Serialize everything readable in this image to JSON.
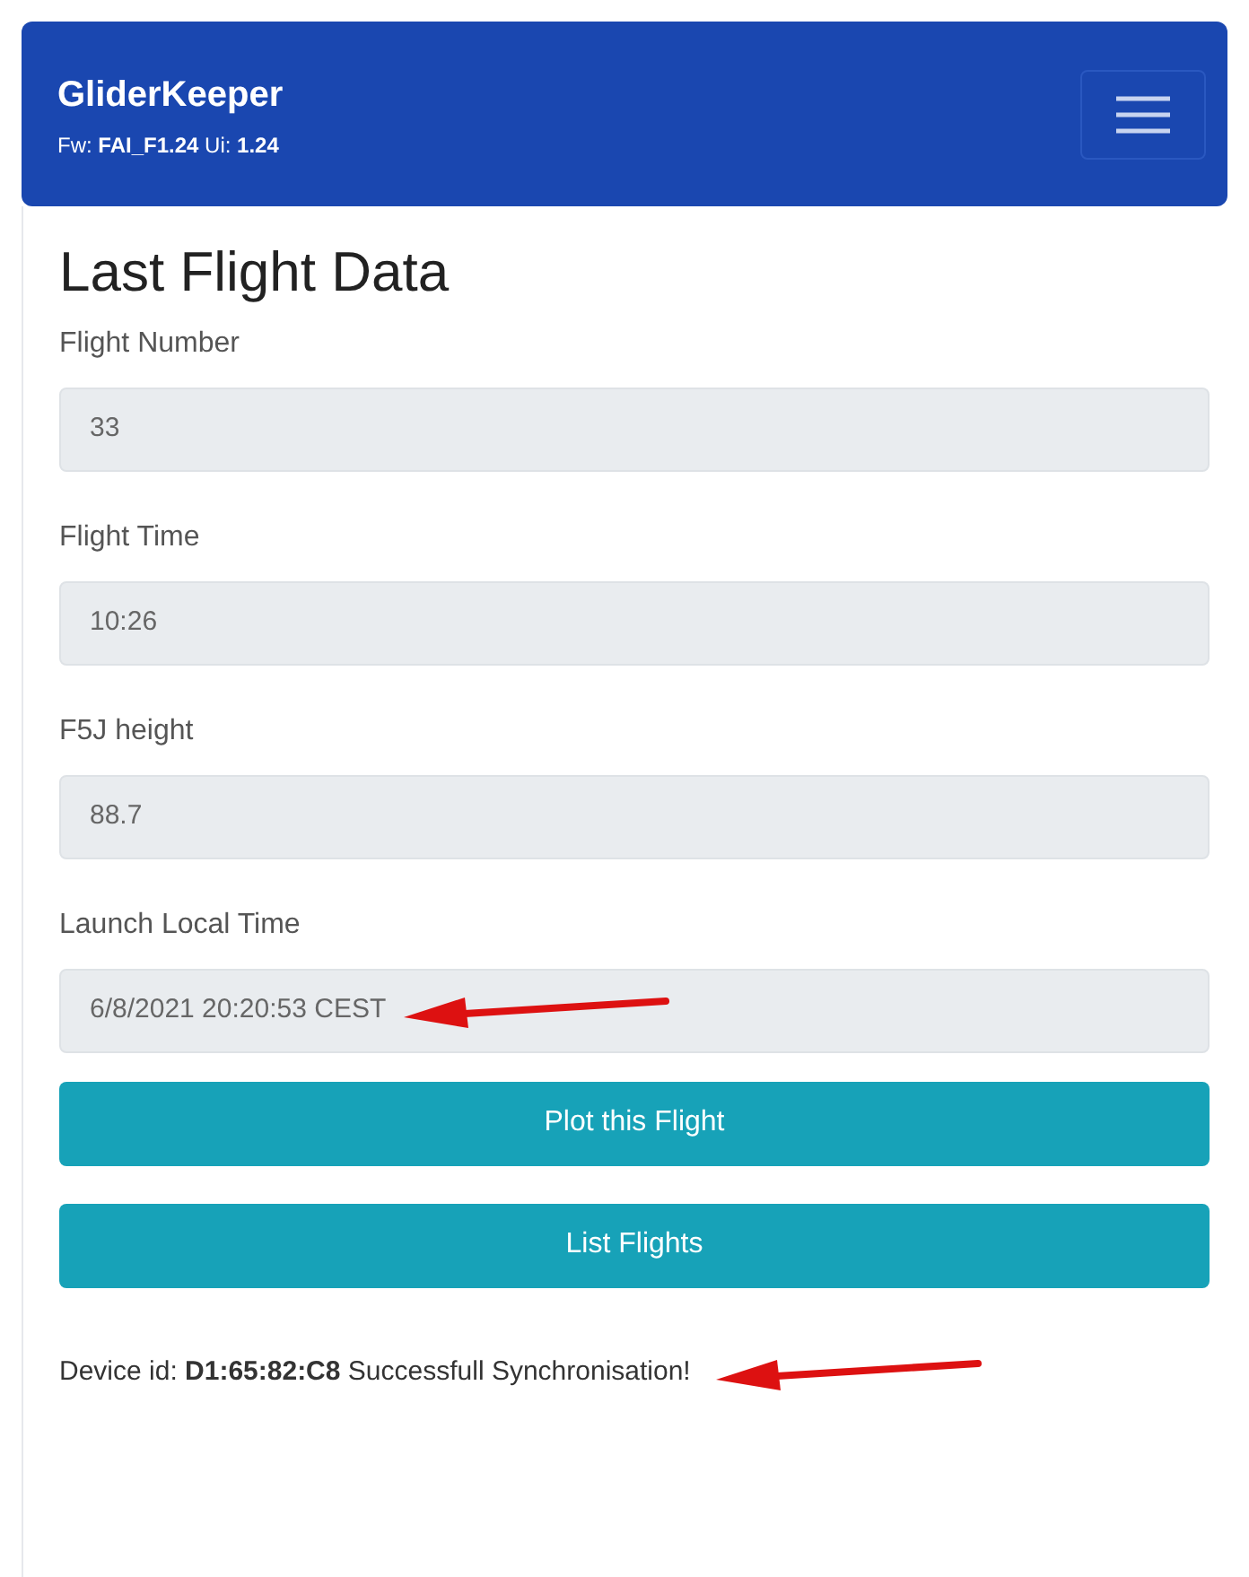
{
  "navbar": {
    "brand": "GliderKeeper",
    "versions": "Fw: **FAI_F1.24** Ui: **1.24**"
  },
  "title": "Last Flight Data",
  "fields": [
    {
      "label": "Flight Number",
      "value": "33",
      "annotated": false
    },
    {
      "label": "Flight Time",
      "value": "10:26",
      "annotated": false
    },
    {
      "label": "F5J height",
      "value": "88.7",
      "annotated": false
    },
    {
      "label": "Launch Local Time",
      "value": "6/8/2021 20:20:53 CEST",
      "annotated": true
    }
  ],
  "buttons": [
    "Plot this Flight",
    "List Flights"
  ],
  "status": {
    "text": "Device id: **D1:65:82:C8** Successfull Synchronisation!",
    "annotated": true
  }
}
